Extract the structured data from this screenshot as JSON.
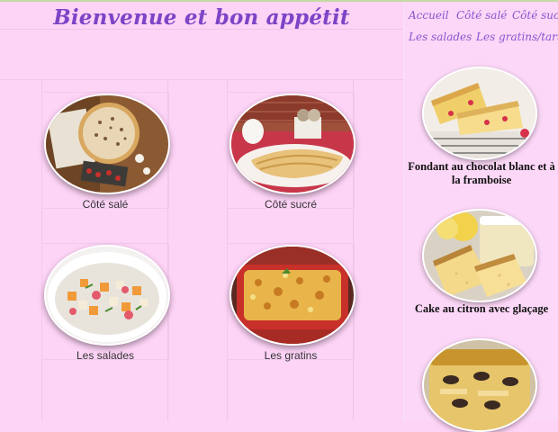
{
  "site": {
    "title": "Bienvenue et bon appétit"
  },
  "nav": {
    "items": [
      {
        "label": "Accueil"
      },
      {
        "label": "Côté salé"
      },
      {
        "label": "Côté sucré"
      },
      {
        "label": "Les salades"
      },
      {
        "label": "Les gratins/tartes"
      }
    ]
  },
  "categories": [
    {
      "label": "Côté salé"
    },
    {
      "label": "Côté sucré"
    },
    {
      "label": "Les salades"
    },
    {
      "label": "Les gratins"
    }
  ],
  "recipes": [
    {
      "title": "Fondant au chocolat blanc et à la framboise"
    },
    {
      "title": "Cake au citron avec glaçage"
    }
  ]
}
